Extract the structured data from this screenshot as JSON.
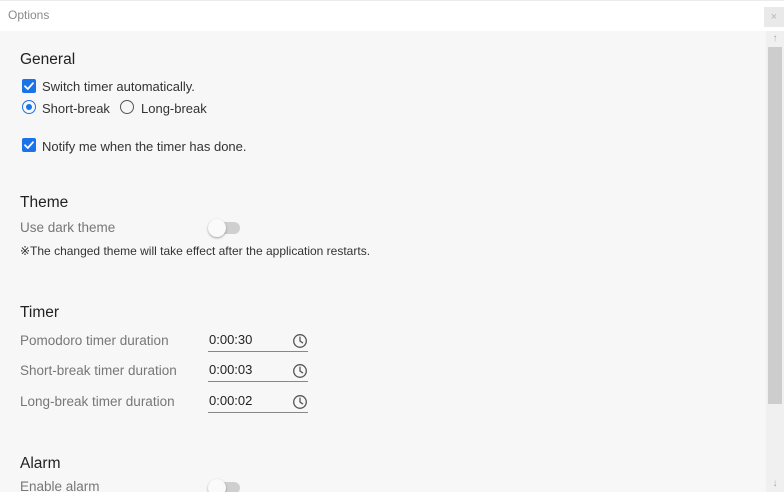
{
  "window": {
    "title": "Options",
    "close_glyph": "×"
  },
  "general": {
    "heading": "General",
    "switch_timer_label": "Switch timer automatically.",
    "switch_timer_checked": true,
    "radio_options": [
      "Short-break",
      "Long-break"
    ],
    "radio_selected": "Short-break",
    "notify_label": "Notify me when the timer has done.",
    "notify_checked": true
  },
  "theme": {
    "heading": "Theme",
    "dark_theme_label": "Use dark theme",
    "dark_theme_on": false,
    "note": "※The changed theme will take effect after the application restarts."
  },
  "timer": {
    "heading": "Timer",
    "pomodoro_label": "Pomodoro timer duration",
    "pomodoro_value": "0:00:30",
    "short_break_label": "Short-break timer duration",
    "short_break_value": "0:00:03",
    "long_break_label": "Long-break timer duration",
    "long_break_value": "0:00:02"
  },
  "alarm": {
    "heading": "Alarm",
    "enable_label": "Enable alarm",
    "enable_on": false
  },
  "scrollbar": {
    "up_glyph": "↑",
    "down_glyph": "↓"
  },
  "colors": {
    "accent": "#1a73e8",
    "background": "#f7f7f7",
    "label_gray": "#777777"
  },
  "icons": {
    "checkbox": "check-icon",
    "time_picker": "clock-icon"
  }
}
